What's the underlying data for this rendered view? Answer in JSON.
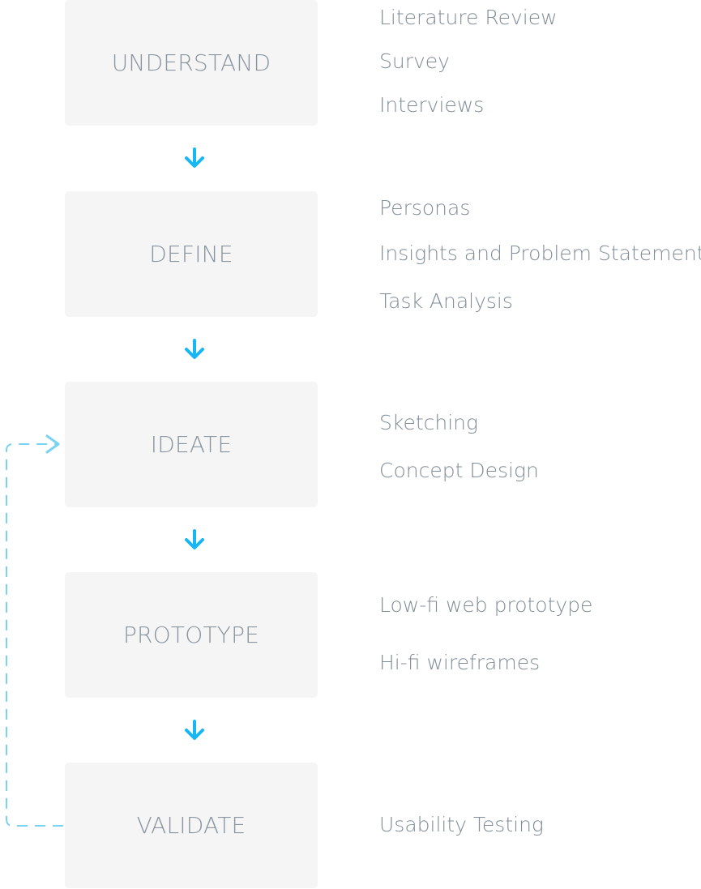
{
  "colors": {
    "box_fill": "#f5f5f5",
    "stage_text": "#8a959f",
    "activity_text": "#828d97",
    "arrow": "#18b6f2",
    "loop_line": "#79d3f3"
  },
  "stages": [
    {
      "label": "UNDERSTAND",
      "activities": [
        "Literature Review",
        "Survey",
        "Interviews"
      ]
    },
    {
      "label": "DEFINE",
      "activities": [
        "Personas",
        "Insights and Problem Statement",
        "Task Analysis"
      ]
    },
    {
      "label": "IDEATE",
      "activities": [
        "Sketching",
        "Concept Design"
      ]
    },
    {
      "label": "PROTOTYPE",
      "activities": [
        "Low-fi web prototype",
        "Hi-fi wireframes"
      ]
    },
    {
      "label": "VALIDATE",
      "activities": [
        "Usability Testing"
      ]
    }
  ]
}
